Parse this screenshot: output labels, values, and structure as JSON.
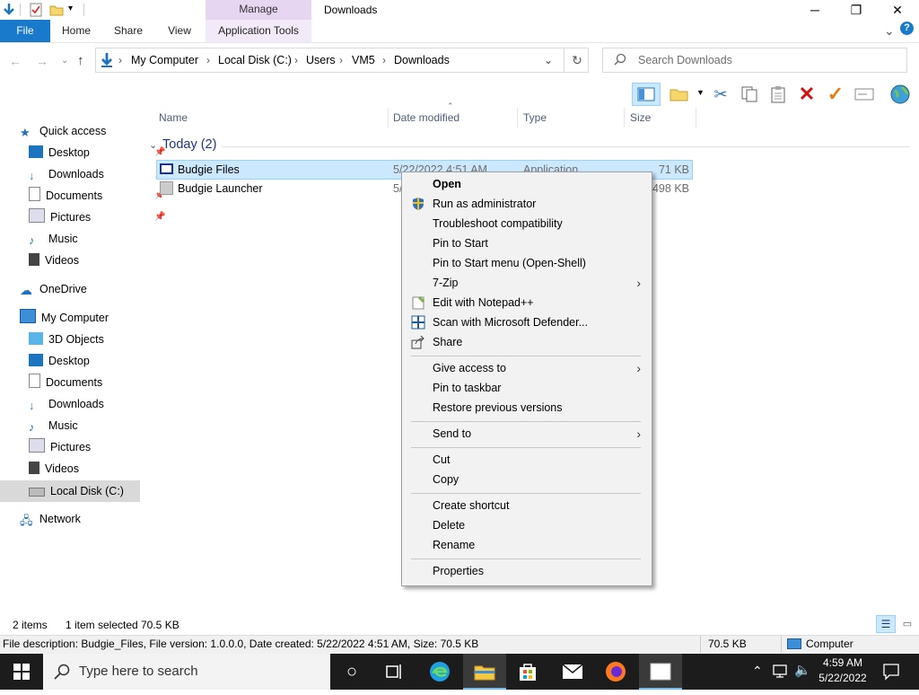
{
  "window": {
    "title": "Downloads",
    "contextual_header": "Manage",
    "minimize": "─",
    "maximize": "❐",
    "close": "✕"
  },
  "ribbon": {
    "tabs": [
      "File",
      "Home",
      "Share",
      "View",
      "Application Tools"
    ],
    "expand": "⌄",
    "help": "?"
  },
  "address": {
    "crumbs": [
      "My Computer",
      "Local Disk (C:)",
      "Users",
      "VM5",
      "Downloads"
    ],
    "separator": "›",
    "search_placeholder": "Search Downloads"
  },
  "nav": {
    "quick_access": "Quick access",
    "quick_items": [
      "Desktop",
      "Downloads",
      "Documents",
      "Pictures",
      "Music",
      "Videos"
    ],
    "onedrive": "OneDrive",
    "my_computer": "My Computer",
    "computer_items": [
      "3D Objects",
      "Desktop",
      "Documents",
      "Downloads",
      "Music",
      "Pictures",
      "Videos",
      "Local Disk (C:)"
    ],
    "network": "Network"
  },
  "columns": [
    "Name",
    "Date modified",
    "Type",
    "Size"
  ],
  "group": "Today (2)",
  "files": [
    {
      "name": "Budgie Files",
      "date": "5/22/2022 4:51 AM",
      "type": "Application",
      "size": "71 KB"
    },
    {
      "name": "Budgie Launcher",
      "date": "5/",
      "type": "",
      "size": "498 KB"
    }
  ],
  "context_menu": {
    "items": [
      {
        "label": "Open",
        "bold": true
      },
      {
        "label": "Run as administrator",
        "icon": "shield-icon"
      },
      {
        "label": "Troubleshoot compatibility"
      },
      {
        "label": "Pin to Start"
      },
      {
        "label": "Pin to Start menu (Open-Shell)"
      },
      {
        "label": "7-Zip",
        "submenu": true
      },
      {
        "label": "Edit with Notepad++",
        "icon": "notepad-plus-plus-icon"
      },
      {
        "label": "Scan with Microsoft Defender...",
        "icon": "defender-icon"
      },
      {
        "label": "Share",
        "icon": "share-icon"
      },
      {
        "label": "Give access to",
        "submenu": true
      },
      {
        "label": "Pin to taskbar"
      },
      {
        "label": "Restore previous versions"
      },
      {
        "label": "Send to",
        "submenu": true
      },
      {
        "label": "Cut"
      },
      {
        "label": "Copy"
      },
      {
        "label": "Create shortcut"
      },
      {
        "label": "Delete"
      },
      {
        "label": "Rename"
      },
      {
        "label": "Properties"
      }
    ],
    "submenu_arrow": "›"
  },
  "status": {
    "items": "2 items",
    "selected": "1 item selected",
    "selected_size": "70.5 KB",
    "description": "File description: Budgie_Files, File version: 1.0.0.0, Date created: 5/22/2022 4:51 AM, Size: 70.5 KB",
    "size": "70.5 KB",
    "location": "Computer"
  },
  "taskbar": {
    "search_placeholder": "Type here to search",
    "time": "4:59 AM",
    "date": "5/22/2022"
  },
  "colors": {
    "file_tab": "#1979ca",
    "manage_tab": "#e6d6f2",
    "selection": "#cce8ff",
    "taskbar": "#1c1c1c"
  }
}
